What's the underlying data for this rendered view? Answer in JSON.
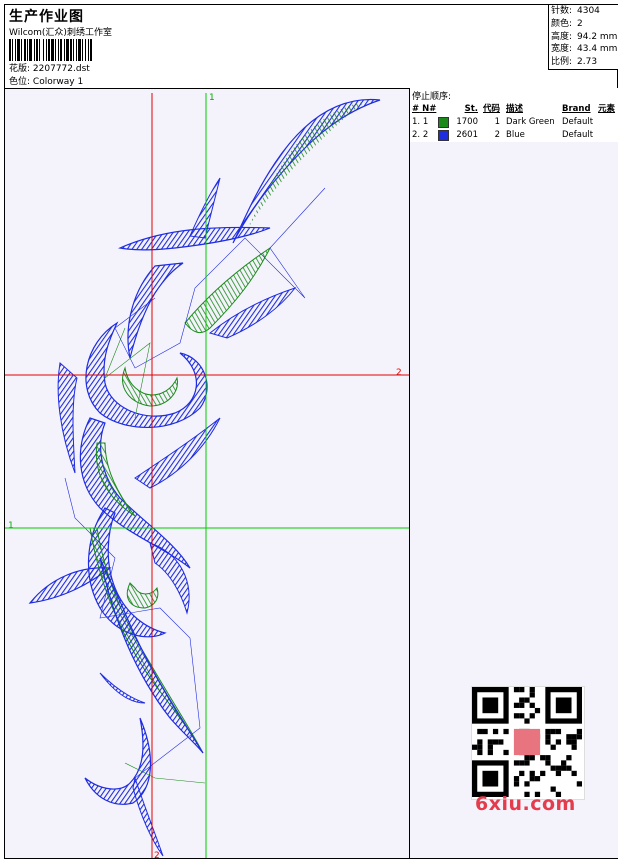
{
  "header": {
    "title": "生产作业图",
    "company": "Wilcom(汇众)刺绣工作室",
    "pattern_label": "花版:",
    "pattern_value": "2207772.dst",
    "colorway_label": "色位:",
    "colorway_value": "Colorway 1"
  },
  "stats": [
    {
      "label": "针数:",
      "value": "4304"
    },
    {
      "label": "颜色:",
      "value": "2"
    },
    {
      "label": "高度:",
      "value": "94.2 mm"
    },
    {
      "label": "宽度:",
      "value": "43.4 mm"
    },
    {
      "label": "比例:",
      "value": "2.73"
    }
  ],
  "stop_sequence": {
    "title": "停止顺序:",
    "columns": [
      "#",
      "N#",
      "St.",
      "代码",
      "描述",
      "Brand",
      "元素"
    ],
    "rows": [
      {
        "idx": "1.",
        "num": "1",
        "color": "#1a8a1a",
        "stitches": "1700",
        "code": "1",
        "desc": "Dark Green",
        "brand": "Default"
      },
      {
        "idx": "2.",
        "num": "2",
        "color": "#1f2de0",
        "stitches": "2601",
        "code": "2",
        "desc": "Blue",
        "brand": "Default"
      }
    ]
  },
  "guides": {
    "green_top": "1",
    "green_left": "1",
    "red_right": "2",
    "red_bottom": "2"
  },
  "colors": {
    "thread_green": "#1a8a1a",
    "thread_blue": "#1f2de0",
    "guide_red": "#e00000",
    "guide_green": "#00cc00",
    "canvas_bg": "#f4f3fb"
  },
  "watermark": "6xiu.com"
}
